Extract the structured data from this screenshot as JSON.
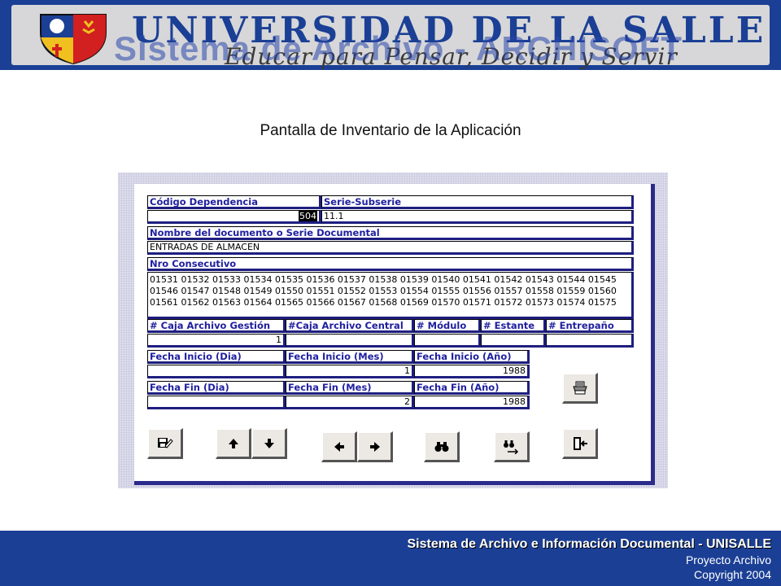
{
  "header": {
    "university": "UNIVERSIDAD DE LA SALLE",
    "motto": "Educar para Pensar, Decidir y Servir",
    "overlay_title": "Sistema de Archivo - ARCHISOFT",
    "brand_color": "#1b3f95"
  },
  "page_title": "Pantalla de Inventario de la Aplicación",
  "form": {
    "codigo_dependencia": {
      "label": "Código Dependencia",
      "value": "504"
    },
    "serie_subserie": {
      "label": "Serie-Subserie",
      "value": "11.1"
    },
    "nombre_documento": {
      "label": "Nombre del documento o Serie Documental",
      "value": "ENTRADAS DE ALMACEN"
    },
    "nro_consecutivo": {
      "label": "Nro Consecutivo",
      "lines": [
        "01531 01532 01533 01534 01535 01536 01537 01538 01539 01540 01541 01542 01543 01544 01545",
        "01546 01547 01548 01549 01550 01551 01552 01553 01554 01555 01556 01557 01558 01559 01560",
        "01561 01562 01563 01564 01565 01566 01567 01568 01569 01570 01571 01572 01573 01574 01575"
      ]
    },
    "caja_gestion": {
      "label": "# Caja Archivo Gestión",
      "value": "1"
    },
    "caja_central": {
      "label": "#Caja Archivo Central",
      "value": ""
    },
    "modulo": {
      "label": "# Módulo",
      "value": ""
    },
    "estante": {
      "label": "# Estante",
      "value": ""
    },
    "entrepano": {
      "label": "# Entrepaño",
      "value": ""
    },
    "fecha_inicio_dia": {
      "label": "Fecha Inicio (Dia)",
      "value": ""
    },
    "fecha_inicio_mes": {
      "label": "Fecha Inicio (Mes)",
      "value": "1"
    },
    "fecha_inicio_ano": {
      "label": "Fecha Inicio (Año)",
      "value": "1988"
    },
    "fecha_fin_dia": {
      "label": "Fecha Fin (Dia)",
      "value": ""
    },
    "fecha_fin_mes": {
      "label": "Fecha Fin (Mes)",
      "value": "2"
    },
    "fecha_fin_ano": {
      "label": "Fecha Fin (Año)",
      "value": "1988"
    }
  },
  "buttons": [
    {
      "name": "save-edit",
      "icon": "disk-pencil-icon"
    },
    {
      "name": "up",
      "icon": "arrow-up-icon"
    },
    {
      "name": "down",
      "icon": "arrow-down-icon"
    },
    {
      "name": "left",
      "icon": "arrow-left-icon"
    },
    {
      "name": "right",
      "icon": "arrow-right-icon"
    },
    {
      "name": "find",
      "icon": "binoculars-icon"
    },
    {
      "name": "find-next",
      "icon": "binoculars-next-icon"
    },
    {
      "name": "print",
      "icon": "printer-icon"
    },
    {
      "name": "exit",
      "icon": "exit-door-icon"
    }
  ],
  "footer": {
    "title": "Sistema de Archivo e Información Documental - UNISALLE",
    "line1": "Proyecto Archivo",
    "line2": "Copyright 2004"
  }
}
